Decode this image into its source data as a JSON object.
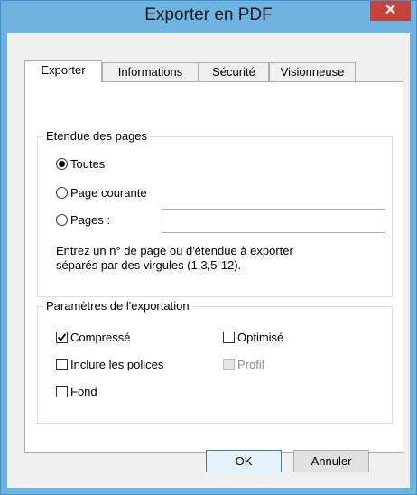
{
  "window": {
    "title": "Exporter en PDF",
    "close_glyph": "✕"
  },
  "tabs": [
    {
      "label": "Exporter",
      "active": true
    },
    {
      "label": "Informations",
      "active": false
    },
    {
      "label": "Sécurité",
      "active": false
    },
    {
      "label": "Visionneuse",
      "active": false
    }
  ],
  "page_range": {
    "title": "Etendue des pages",
    "options": [
      {
        "label": "Toutes",
        "selected": true
      },
      {
        "label": "Page courante",
        "selected": false
      },
      {
        "label": "Pages :",
        "selected": false
      }
    ],
    "pages_value": "",
    "hint_line1": "Entrez un n° de page ou d'étendue à exporter",
    "hint_line2": "séparés par des virgules (1,3,5-12)."
  },
  "export_params": {
    "title": "Paramètres de l'exportation",
    "compress": {
      "label": "Compressé",
      "checked": true
    },
    "optimize": {
      "label": "Optimisé",
      "checked": false
    },
    "include_fonts": {
      "label": "Inclure les polices",
      "checked": false
    },
    "profile": {
      "label": "Profil",
      "checked": false,
      "disabled": true
    },
    "background": {
      "label": "Fond",
      "checked": false
    }
  },
  "buttons": {
    "ok": "OK",
    "cancel": "Annuler"
  }
}
